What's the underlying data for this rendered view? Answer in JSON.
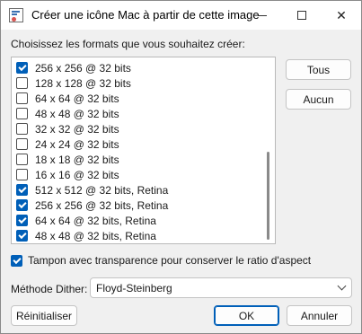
{
  "window": {
    "title": "Créer une icône Mac à partir de cette image"
  },
  "formats": {
    "label": "Choisissez les formats que vous souhaitez créer:",
    "items": [
      {
        "label": "256 x 256 @ 32 bits",
        "checked": true
      },
      {
        "label": "128 x 128 @ 32 bits",
        "checked": false
      },
      {
        "label": "64 x 64 @ 32 bits",
        "checked": false
      },
      {
        "label": "48 x 48 @ 32 bits",
        "checked": false
      },
      {
        "label": "32 x 32 @ 32 bits",
        "checked": false
      },
      {
        "label": "24 x 24 @ 32 bits",
        "checked": false
      },
      {
        "label": "18 x 18 @ 32 bits",
        "checked": false
      },
      {
        "label": "16 x 16 @ 32 bits",
        "checked": false
      },
      {
        "label": "512 x 512 @ 32 bits, Retina",
        "checked": true
      },
      {
        "label": "256 x 256 @ 32 bits, Retina",
        "checked": true
      },
      {
        "label": "64 x 64 @ 32 bits, Retina",
        "checked": true
      },
      {
        "label": "48 x 48 @ 32 bits, Retina",
        "checked": true
      }
    ],
    "all_button": "Tous",
    "none_button": "Aucun"
  },
  "padding": {
    "label": "Tampon avec transparence pour conserver le ratio d'aspect",
    "checked": true
  },
  "dither": {
    "label": "Méthode Dither:",
    "value": "Floyd-Steinberg"
  },
  "buttons": {
    "reset": "Réinitialiser",
    "ok": "OK",
    "cancel": "Annuler"
  },
  "colors": {
    "accent": "#005fb8"
  }
}
